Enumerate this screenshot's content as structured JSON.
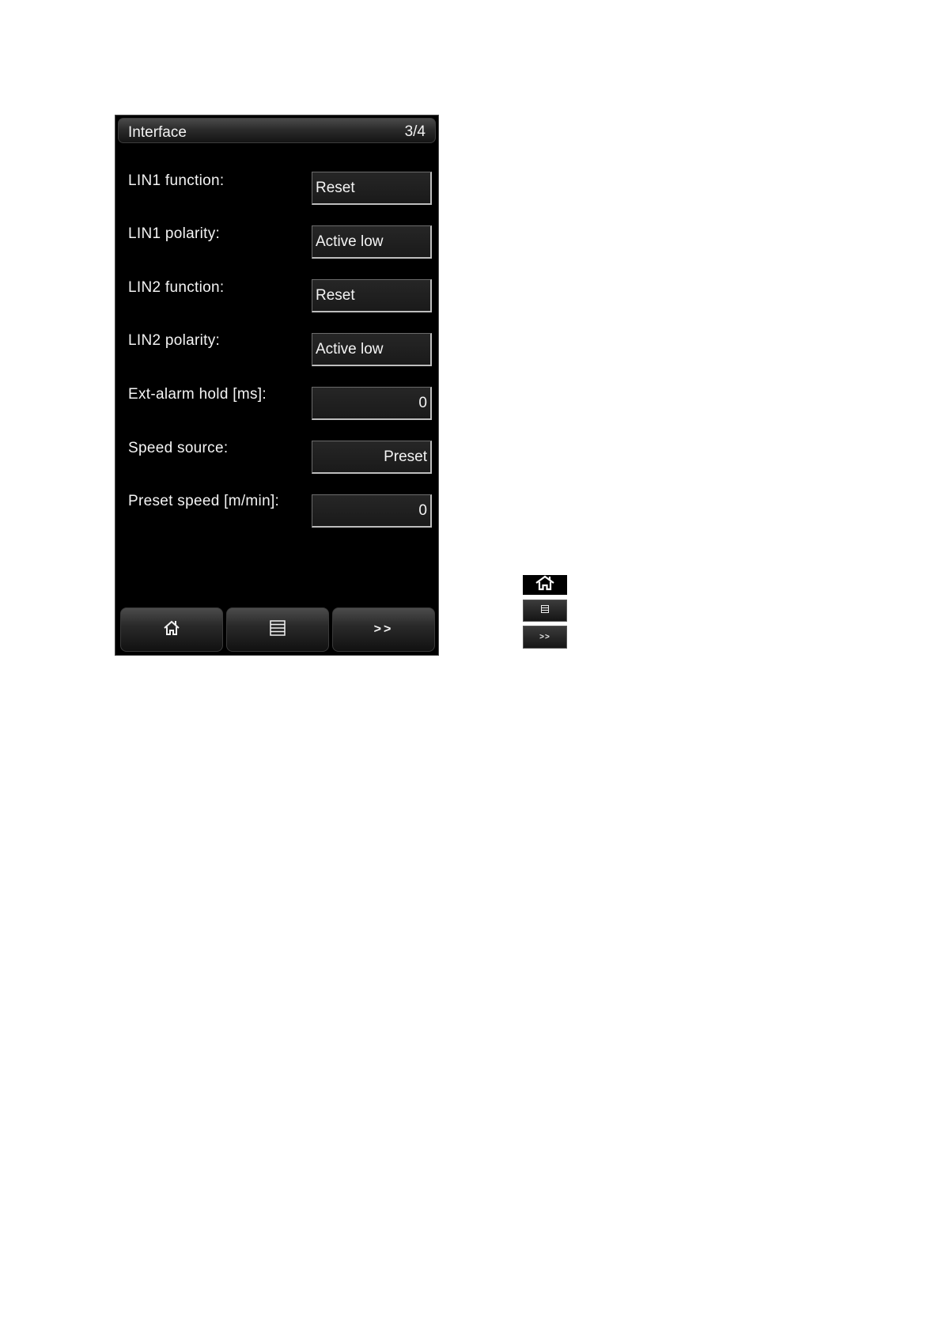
{
  "screen": {
    "title": "Interface",
    "page_indicator": "3/4",
    "rows": [
      {
        "label": "LIN1 function:",
        "value": "Reset"
      },
      {
        "label": "LIN1 polarity:",
        "value": "Active low"
      },
      {
        "label": "LIN2 function:",
        "value": "Reset"
      },
      {
        "label": "LIN2 polarity:",
        "value": "Active low"
      },
      {
        "label": "Ext-alarm hold [ms]:",
        "value": "0"
      },
      {
        "label": "Speed source:",
        "value": "Preset"
      },
      {
        "label": "Preset speed [m/min]:",
        "value": "0"
      }
    ],
    "softkeys": {
      "home_icon": "home-icon",
      "menu_icon": "menu-list-icon",
      "next_label": ">>"
    }
  },
  "legend": {
    "home_icon": "home-icon",
    "menu_icon": "menu-list-icon",
    "next_label": ">>"
  }
}
